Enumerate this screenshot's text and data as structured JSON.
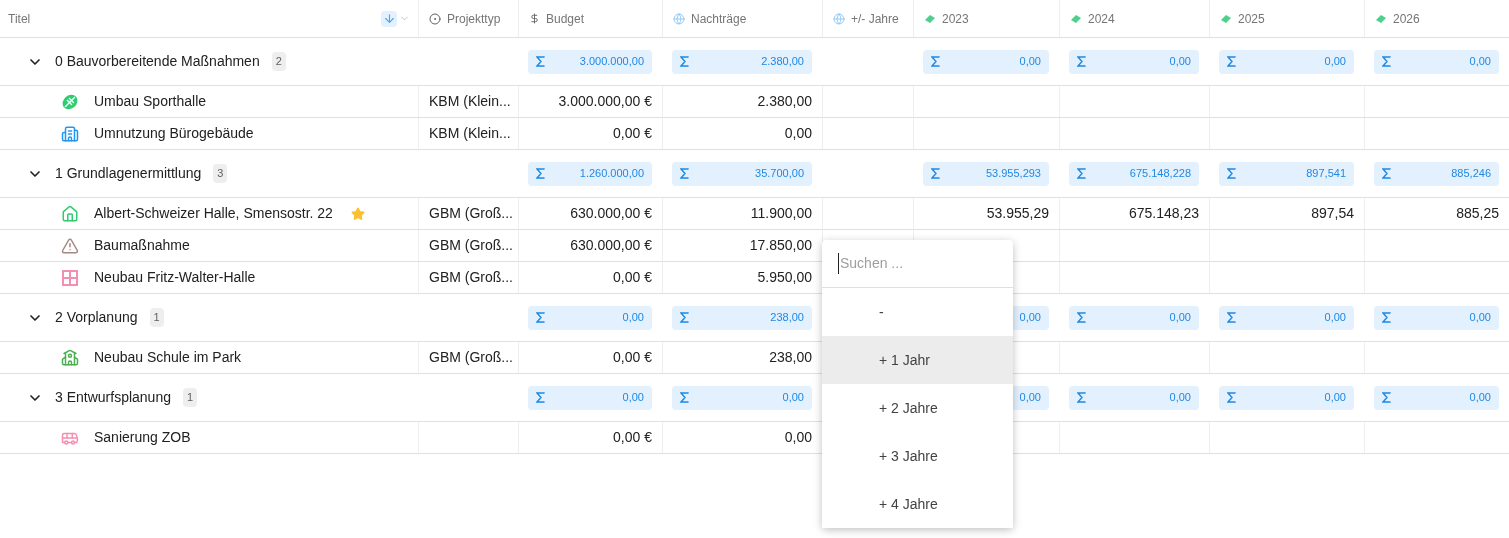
{
  "columns": [
    {
      "label": "Titel",
      "kind": "title"
    },
    {
      "label": "Projekttyp",
      "kind": "select"
    },
    {
      "label": "Budget",
      "kind": "currency"
    },
    {
      "label": "Nachträge",
      "kind": "globe"
    },
    {
      "label": "+/- Jahre",
      "kind": "globe"
    },
    {
      "label": "2023",
      "kind": "money"
    },
    {
      "label": "2024",
      "kind": "money"
    },
    {
      "label": "2025",
      "kind": "money"
    },
    {
      "label": "2026",
      "kind": "money"
    }
  ],
  "groups": [
    {
      "title": "0 Bauvorbereitende Maßnahmen",
      "count": "2",
      "expanded": true,
      "sums": {
        "budget": "3.000.000,00",
        "nachtraege": "2.380,00",
        "years": [
          "0,00",
          "0,00",
          "0,00",
          "0,00"
        ]
      },
      "items": [
        {
          "title": "Umbau Sporthalle",
          "kind": "ball",
          "color": "#2ecc71",
          "starred": false,
          "projekttyp": "KBM (Klein...",
          "budget": "3.000.000,00 €",
          "nachtraege": "2.380,00"
        },
        {
          "title": "Umnutzung Bürogebäude",
          "kind": "office",
          "color": "#2196f3",
          "starred": false,
          "projekttyp": "KBM (Klein...",
          "budget": "0,00 €",
          "nachtraege": "0,00"
        }
      ]
    },
    {
      "title": "1 Grundlagenermittlung",
      "count": "3",
      "expanded": true,
      "sums": {
        "budget": "1.260.000,00",
        "nachtraege": "35.700,00",
        "years": [
          "53.955,293",
          "675.148,228",
          "897,541",
          "885,246"
        ]
      },
      "items": [
        {
          "title": "Albert-Schweizer Halle, Smensostr. 22",
          "kind": "house",
          "color": "#2ecc71",
          "starred": true,
          "projekttyp": "GBM (Groß...",
          "budget": "630.000,00 €",
          "nachtraege": "11.900,00",
          "years": [
            "53.955,29",
            "675.148,23",
            "897,54",
            "885,25"
          ]
        },
        {
          "title": "Baumaßnahme",
          "kind": "warning",
          "color": "#a1887f",
          "starred": false,
          "projekttyp": "GBM (Groß...",
          "budget": "630.000,00 €",
          "nachtraege": "17.850,00"
        },
        {
          "title": "Neubau Fritz-Walter-Halle",
          "kind": "window",
          "color": "#f48fb1",
          "starred": false,
          "projekttyp": "GBM (Groß...",
          "budget": "0,00 €",
          "nachtraege": "5.950,00"
        }
      ]
    },
    {
      "title": "2 Vorplanung",
      "count": "1",
      "expanded": true,
      "sums": {
        "budget": "0,00",
        "nachtraege": "238,00",
        "years": [
          "0,00",
          "0,00",
          "0,00",
          "0,00"
        ],
        "first_year_sum_under_menu": true
      },
      "items": [
        {
          "title": "Neubau Schule im Park",
          "kind": "school",
          "color": "#4caf50",
          "starred": false,
          "projekttyp": "GBM (Groß...",
          "budget": "0,00 €",
          "nachtraege": "238,00"
        }
      ]
    },
    {
      "title": "3 Entwurfsplanung",
      "count": "1",
      "expanded": true,
      "sums": {
        "budget": "0,00",
        "nachtraege": "0,00",
        "years": [
          "0,00",
          "0,00",
          "0,00",
          "0,00"
        ],
        "first_year_sum_under_menu": true
      },
      "items": [
        {
          "title": "Sanierung ZOB",
          "kind": "bus",
          "color": "#f48fb1",
          "starred": false,
          "budget": "0,00 €",
          "nachtraege": "0,00"
        }
      ]
    }
  ],
  "dropdown": {
    "placeholder": "Suchen ...",
    "options": [
      {
        "label": "-",
        "highlighted": false
      },
      {
        "label": "+ 1 Jahr",
        "highlighted": true
      },
      {
        "label": "+ 2 Jahre",
        "highlighted": false
      },
      {
        "label": "+ 3 Jahre",
        "highlighted": false
      },
      {
        "label": "+ 4 Jahre",
        "highlighted": false
      }
    ]
  }
}
